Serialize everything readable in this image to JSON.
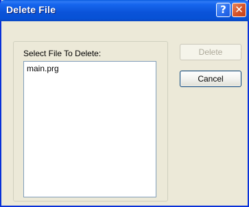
{
  "window": {
    "title": "Delete File"
  },
  "titlebar": {
    "help_glyph": "?",
    "close_glyph": "✕",
    "help_icon": "help-icon",
    "close_icon": "close-icon"
  },
  "file_group": {
    "label": "Select File To Delete:",
    "files": [
      "main.prg"
    ]
  },
  "buttons": {
    "delete_label": "Delete",
    "delete_enabled": false,
    "cancel_label": "Cancel"
  },
  "colors": {
    "titlebar_blue": "#0a53d8",
    "dialog_face": "#ece9d8",
    "close_red": "#d45228",
    "disabled_text": "#aca899"
  }
}
